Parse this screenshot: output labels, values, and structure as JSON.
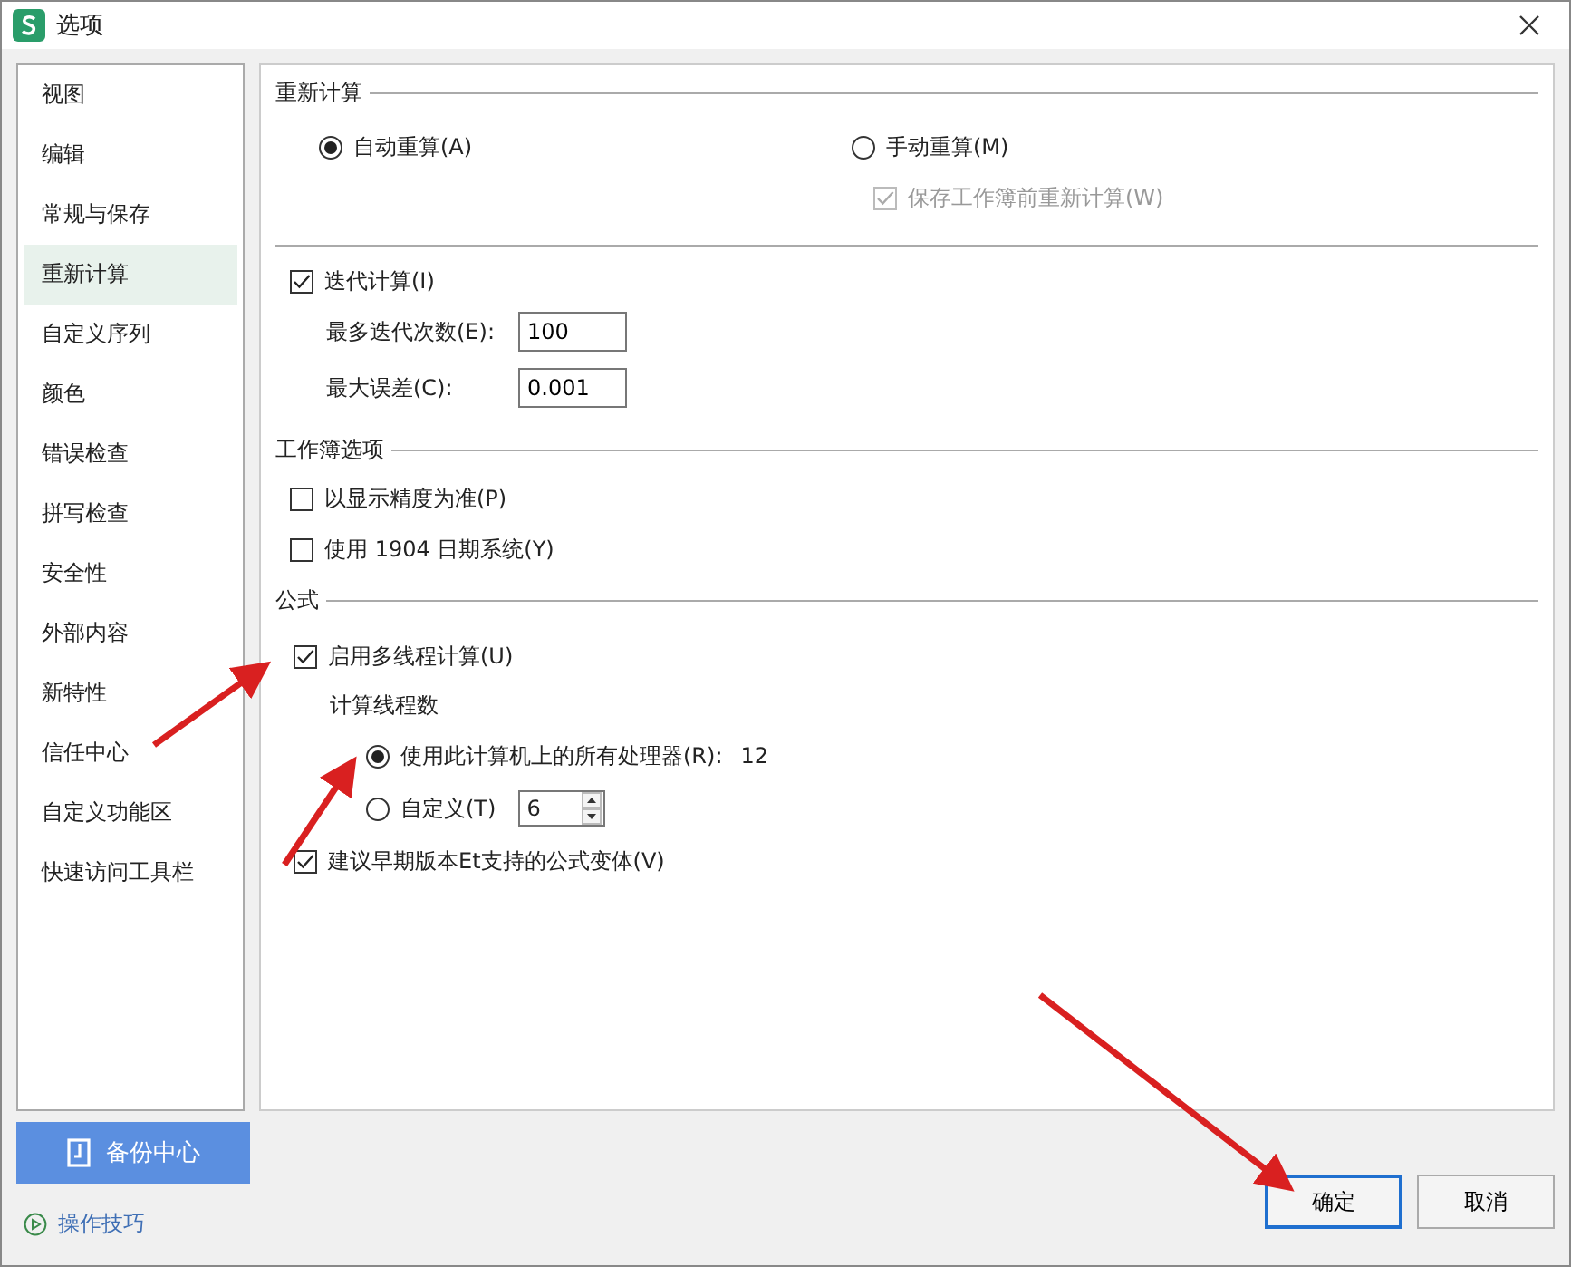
{
  "window": {
    "title": "选项"
  },
  "sidebar": {
    "items": [
      {
        "label": "视图",
        "selected": false
      },
      {
        "label": "编辑",
        "selected": false
      },
      {
        "label": "常规与保存",
        "selected": false
      },
      {
        "label": "重新计算",
        "selected": true
      },
      {
        "label": "自定义序列",
        "selected": false
      },
      {
        "label": "颜色",
        "selected": false
      },
      {
        "label": "错误检查",
        "selected": false
      },
      {
        "label": "拼写检查",
        "selected": false
      },
      {
        "label": "安全性",
        "selected": false
      },
      {
        "label": "外部内容",
        "selected": false
      },
      {
        "label": "新特性",
        "selected": false
      },
      {
        "label": "信任中心",
        "selected": false
      },
      {
        "label": "自定义功能区",
        "selected": false
      },
      {
        "label": "快速访问工具栏",
        "selected": false
      }
    ]
  },
  "recalc": {
    "title": "重新计算",
    "auto": {
      "label": "自动重算(A)",
      "selected": true
    },
    "manual": {
      "label": "手动重算(M)",
      "selected": false
    },
    "save_recalc": {
      "label": "保存工作簿前重新计算(W)",
      "checked": true,
      "disabled": true
    }
  },
  "iteration": {
    "label": "迭代计算(I)",
    "checked": true,
    "max_iterations": {
      "label": "最多迭代次数(E):",
      "value": "100"
    },
    "max_change": {
      "label": "最大误差(C):",
      "value": "0.001"
    }
  },
  "workbook": {
    "title": "工作簿选项",
    "options": [
      {
        "label": "以显示精度为准(P)",
        "checked": false
      },
      {
        "label": "使用 1904 日期系统(Y)",
        "checked": false
      }
    ]
  },
  "formula": {
    "title": "公式",
    "multithread": {
      "label": "启用多线程计算(U)",
      "checked": true
    },
    "threads_title": "计算线程数",
    "all_processors": {
      "label": "使用此计算机上的所有处理器(R):",
      "count": "12",
      "selected": true
    },
    "custom": {
      "label": "自定义(T)",
      "value": "6",
      "selected": false
    },
    "compat": {
      "label": "建议早期版本Et支持的公式变体(V)",
      "checked": true
    }
  },
  "backup_button": "备份中心",
  "tips_link": "操作技巧",
  "buttons": {
    "ok": "确定",
    "cancel": "取消"
  }
}
